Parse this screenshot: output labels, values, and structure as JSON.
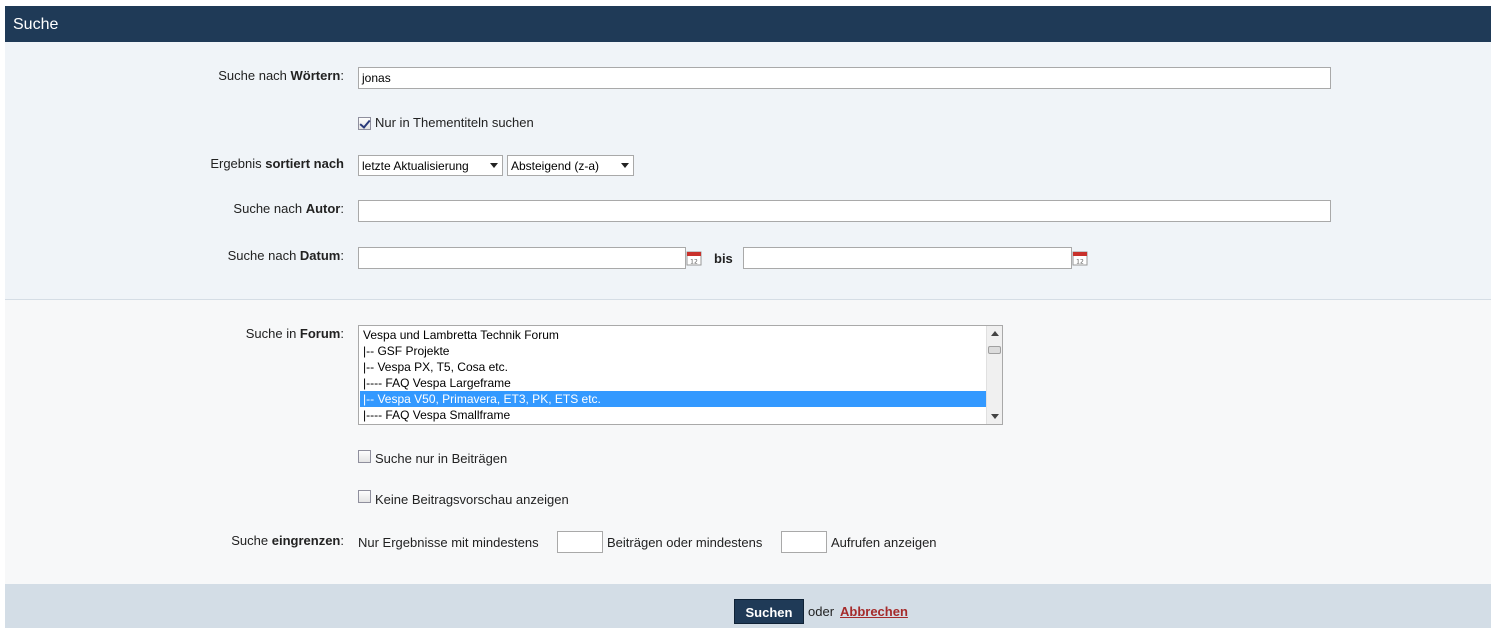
{
  "header": {
    "title": "Suche"
  },
  "fields": {
    "words": {
      "label_pre": "Suche nach ",
      "label_bold": "Wörtern",
      "label_post": ":",
      "value": "jonas"
    },
    "titles_only": {
      "label": "Nur in Thementiteln suchen",
      "checked": true
    },
    "sort": {
      "label_pre": "Ergebnis ",
      "label_bold": "sortiert nach",
      "order_by": "letzte Aktualisierung",
      "direction": "Absteigend (z-a)"
    },
    "author": {
      "label_pre": "Suche nach ",
      "label_bold": "Autor",
      "label_post": ":",
      "value": ""
    },
    "date": {
      "label_pre": "Suche nach ",
      "label_bold": "Datum",
      "label_post": ":",
      "from": "",
      "to": "",
      "bis": "bis"
    },
    "forum": {
      "label_pre": "Suche in ",
      "label_bold": "Forum",
      "label_post": ":",
      "options": [
        "Vespa und Lambretta Technik Forum",
        "|-- GSF Projekte",
        "|-- Vespa PX, T5, Cosa etc.",
        "|---- FAQ Vespa Largeframe",
        "|-- Vespa V50, Primavera, ET3, PK, ETS etc.",
        "|---- FAQ Vespa Smallframe"
      ],
      "selected_index": 4
    },
    "posts_only": {
      "label": "Suche nur in Beiträgen",
      "checked": false
    },
    "no_preview": {
      "label": "Keine Beitragsvorschau anzeigen",
      "checked": false
    },
    "limit": {
      "label_pre": "Suche ",
      "label_bold": "eingrenzen",
      "label_post": ":",
      "text1": "Nur Ergebnisse mit mindestens",
      "text2": "Beiträgen oder mindestens",
      "text3": "Aufrufen anzeigen",
      "min_posts": "",
      "min_views": ""
    }
  },
  "actions": {
    "search": "Suchen",
    "or": "oder",
    "cancel": "Abbrechen"
  },
  "colors": {
    "header_bg": "#1f3a57",
    "selection": "#3399ff",
    "cancel_link": "#a52a2a"
  }
}
